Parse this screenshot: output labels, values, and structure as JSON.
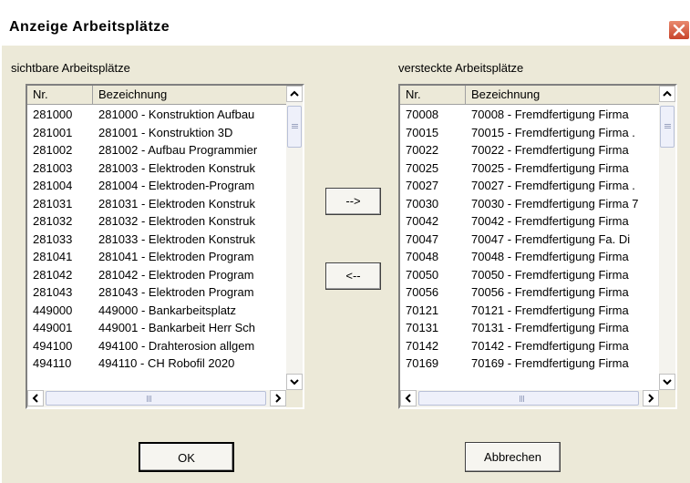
{
  "window": {
    "title": "Anzeige Arbeitsplätze"
  },
  "visible_list": {
    "label": "sichtbare Arbeitsplätze",
    "columns": {
      "nr": "Nr.",
      "bezeichnung": "Bezeichnung"
    },
    "rows": [
      {
        "nr": "281000",
        "bezeichnung": "281000 - Konstruktion Aufbau"
      },
      {
        "nr": "281001",
        "bezeichnung": "281001 - Konstruktion 3D"
      },
      {
        "nr": "281002",
        "bezeichnung": "281002 - Aufbau Programmier"
      },
      {
        "nr": "281003",
        "bezeichnung": "281003 - Elektroden Konstruk"
      },
      {
        "nr": "281004",
        "bezeichnung": "281004 - Elektroden-Program"
      },
      {
        "nr": "281031",
        "bezeichnung": "281031 - Elektroden Konstruk"
      },
      {
        "nr": "281032",
        "bezeichnung": "281032 - Elektroden Konstruk"
      },
      {
        "nr": "281033",
        "bezeichnung": "281033 - Elektroden Konstruk"
      },
      {
        "nr": "281041",
        "bezeichnung": "281041 - Elektroden Program"
      },
      {
        "nr": "281042",
        "bezeichnung": "281042 - Elektroden Program"
      },
      {
        "nr": "281043",
        "bezeichnung": "281043 - Elektroden Program"
      },
      {
        "nr": "449000",
        "bezeichnung": "449000 - Bankarbeitsplatz"
      },
      {
        "nr": "449001",
        "bezeichnung": "449001 - Bankarbeit Herr Sch"
      },
      {
        "nr": "494100",
        "bezeichnung": "494100 - Drahterosion allgem"
      },
      {
        "nr": "494110",
        "bezeichnung": "494110 - CH Robofil 2020"
      }
    ]
  },
  "hidden_list": {
    "label": "versteckte Arbeitsplätze",
    "columns": {
      "nr": "Nr.",
      "bezeichnung": "Bezeichnung"
    },
    "rows": [
      {
        "nr": "70008",
        "bezeichnung": "70008 - Fremdfertigung Firma"
      },
      {
        "nr": "70015",
        "bezeichnung": "70015 - Fremdfertigung Firma ."
      },
      {
        "nr": "70022",
        "bezeichnung": "70022 - Fremdfertigung Firma"
      },
      {
        "nr": "70025",
        "bezeichnung": "70025 - Fremdfertigung Firma"
      },
      {
        "nr": "70027",
        "bezeichnung": "70027 - Fremdfertigung Firma ."
      },
      {
        "nr": "70030",
        "bezeichnung": "70030 - Fremdfertigung Firma 7"
      },
      {
        "nr": "70042",
        "bezeichnung": "70042 - Fremdfertigung Firma"
      },
      {
        "nr": "70047",
        "bezeichnung": "70047 - Fremdfertigung Fa. Di"
      },
      {
        "nr": "70048",
        "bezeichnung": "70048 - Fremdfertigung Firma"
      },
      {
        "nr": "70050",
        "bezeichnung": "70050 - Fremdfertigung Firma"
      },
      {
        "nr": "70056",
        "bezeichnung": "70056 - Fremdfertigung Firma"
      },
      {
        "nr": "70121",
        "bezeichnung": "70121 - Fremdfertigung Firma"
      },
      {
        "nr": "70131",
        "bezeichnung": "70131 - Fremdfertigung Firma"
      },
      {
        "nr": "70142",
        "bezeichnung": "70142 - Fremdfertigung Firma"
      },
      {
        "nr": "70169",
        "bezeichnung": "70169 - Fremdfertigung Firma"
      }
    ]
  },
  "buttons": {
    "move_right": "-->",
    "move_left": "<--",
    "ok": "OK",
    "cancel": "Abbrechen"
  },
  "icons": {
    "close": "close-icon",
    "scroll_up": "arrow-up-icon",
    "scroll_down": "arrow-down-icon",
    "scroll_left": "arrow-left-icon",
    "scroll_right": "arrow-right-icon"
  },
  "colors": {
    "close_button": "#d0543a",
    "dialog_background": "#ece9d8",
    "list_background": "#ffffff"
  }
}
